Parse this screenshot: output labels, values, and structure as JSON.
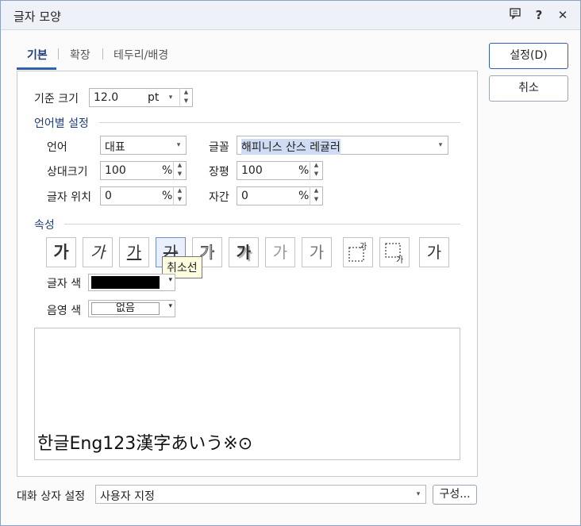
{
  "window": {
    "title": "글자 모양"
  },
  "titlebar_icons": [
    "comment-icon",
    "help-icon",
    "close-icon"
  ],
  "titlebar_glyphs": {
    "help": "?",
    "close": "✕"
  },
  "tabs": [
    {
      "label": "기본",
      "active": true
    },
    {
      "label": "확장",
      "active": false
    },
    {
      "label": "테두리/배경",
      "active": false
    }
  ],
  "buttons": {
    "ok": "설정(D)",
    "cancel": "취소",
    "config": "구성..."
  },
  "base_size": {
    "label": "기준 크기",
    "value": "12.0",
    "unit": "pt"
  },
  "lang_section": {
    "title": "언어별 설정",
    "language": {
      "label": "언어",
      "value": "대표"
    },
    "font": {
      "label": "글꼴",
      "value": "해피니스 산스 레귤러"
    },
    "rel_size": {
      "label": "상대크기",
      "value": "100",
      "unit": "%"
    },
    "width": {
      "label": "장평",
      "value": "100",
      "unit": "%"
    },
    "position": {
      "label": "글자 위치",
      "value": "0",
      "unit": "%"
    },
    "spacing": {
      "label": "자간",
      "value": "0",
      "unit": "%"
    }
  },
  "attr_section": {
    "title": "속성",
    "buttons": [
      {
        "name": "bold-button",
        "glyph": "가"
      },
      {
        "name": "italic-button",
        "glyph": "가"
      },
      {
        "name": "underline-button",
        "glyph": "가"
      },
      {
        "name": "strikethrough-button",
        "glyph": "가"
      },
      {
        "name": "outline-button",
        "glyph": "가"
      },
      {
        "name": "shadow-button",
        "glyph": "가"
      },
      {
        "name": "emboss-button",
        "glyph": "가"
      },
      {
        "name": "engrave-button",
        "glyph": "가"
      },
      {
        "name": "superscript-button",
        "glyph": "가"
      },
      {
        "name": "subscript-button",
        "glyph": "가"
      },
      {
        "name": "normal-button",
        "glyph": "가"
      }
    ],
    "tooltip": "취소선",
    "text_color": {
      "label": "글자 색",
      "color": "#000000"
    },
    "shade_color": {
      "label": "음영 색",
      "value": "없음"
    }
  },
  "preview": {
    "text": "한글Eng123漢字あいう※⊙"
  },
  "footer": {
    "label": "대화 상자 설정",
    "value": "사용자 지정"
  },
  "colors": {
    "accent": "#2f5fb3",
    "section": "#1f3d7a"
  }
}
